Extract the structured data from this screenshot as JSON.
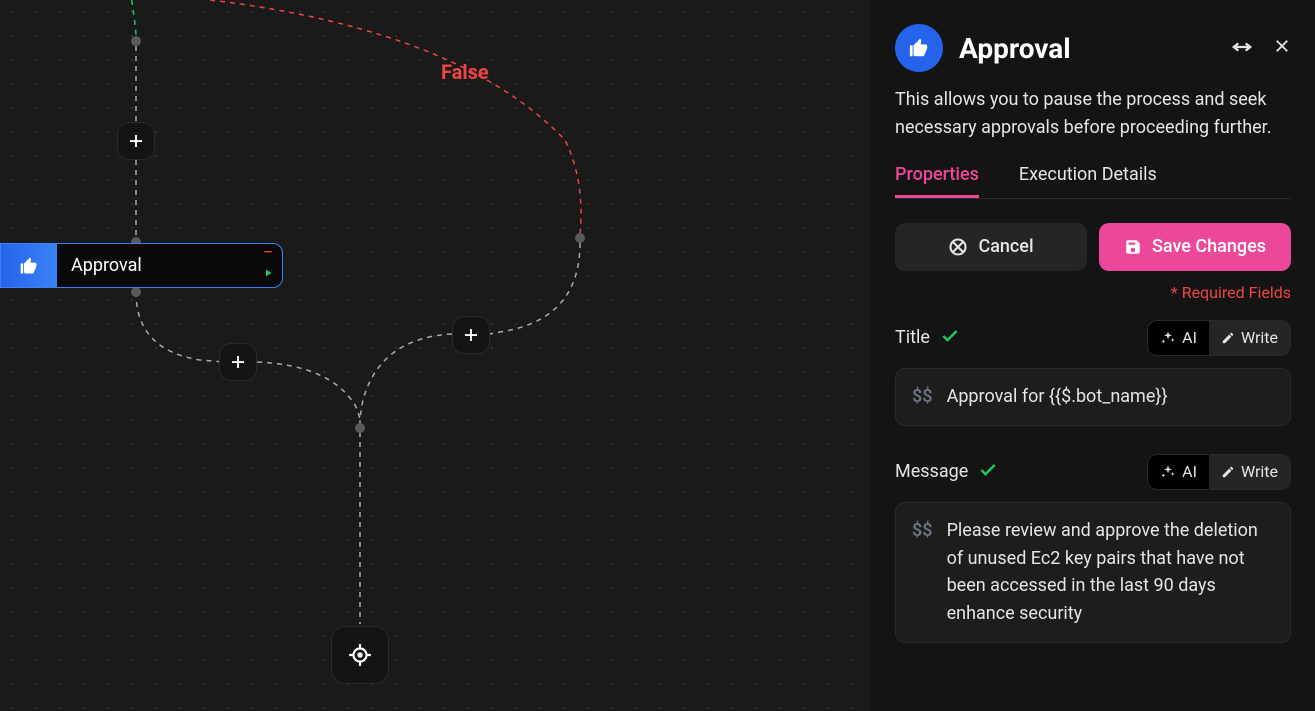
{
  "canvas": {
    "false_label": "False",
    "node_label": "Approval"
  },
  "sidebar": {
    "title": "Approval",
    "description": "This allows you to pause the process and seek necessary approvals before proceeding further.",
    "tabs": {
      "properties": "Properties",
      "execution": "Execution Details"
    },
    "buttons": {
      "cancel": "Cancel",
      "save": "Save Changes"
    },
    "required_fields": "* Required Fields",
    "ai_label": "AI",
    "write_label": "Write",
    "dollar_label": "$$",
    "fields": {
      "title": {
        "label": "Title",
        "value": "Approval for {{$.bot_name}}"
      },
      "message": {
        "label": "Message",
        "value": "Please review and approve the deletion of unused  Ec2 key pairs that have not been accessed in the last 90 days enhance security"
      }
    }
  }
}
